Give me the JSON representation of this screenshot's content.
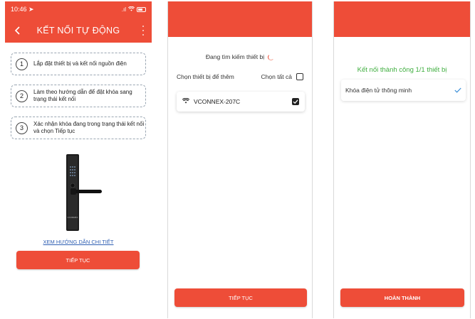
{
  "screen1": {
    "status": {
      "time": "10:46",
      "signal": ".ıl"
    },
    "title": "KẾT NỐI TỰ ĐỘNG",
    "steps": [
      {
        "num": "1",
        "text": "Lắp đặt thiết bị và kết nối nguồn điện"
      },
      {
        "num": "2",
        "text": "Làm theo hướng dẫn để đặt khóa sang trạng thái kết nối"
      },
      {
        "num": "3",
        "text": "Xác nhận khóa đang trong trạng thái kết nối và chọn Tiếp tục"
      }
    ],
    "guide_link": "XEM HƯỚNG DẪN CHI TIẾT",
    "continue_label": "TIẾP TỤC",
    "lock_brand": "VCONNEX"
  },
  "screen2": {
    "searching": "Đang tìm kiếm thiết bị",
    "select_device": "Chọn thiết bị để thêm",
    "select_all": "Chọn tất cả",
    "device_name": "VCONNEX-207C",
    "continue_label": "TIẾP TỤC"
  },
  "screen3": {
    "success": "Kết nối thành công 1/1 thiết bị",
    "device_name": "Khóa điện tử thông minh",
    "done_label": "HOÀN THÀNH"
  },
  "colors": {
    "accent": "#ee4d38",
    "success": "#3fae3f",
    "link": "#2f5fb3",
    "check": "#3b8fd8"
  },
  "icons": [
    "location-arrow-icon",
    "signal-icon",
    "wifi-icon",
    "battery-icon",
    "back-chevron-icon",
    "more-vertical-icon",
    "spinner-icon",
    "checkbox-icon",
    "checkmark-icon"
  ]
}
